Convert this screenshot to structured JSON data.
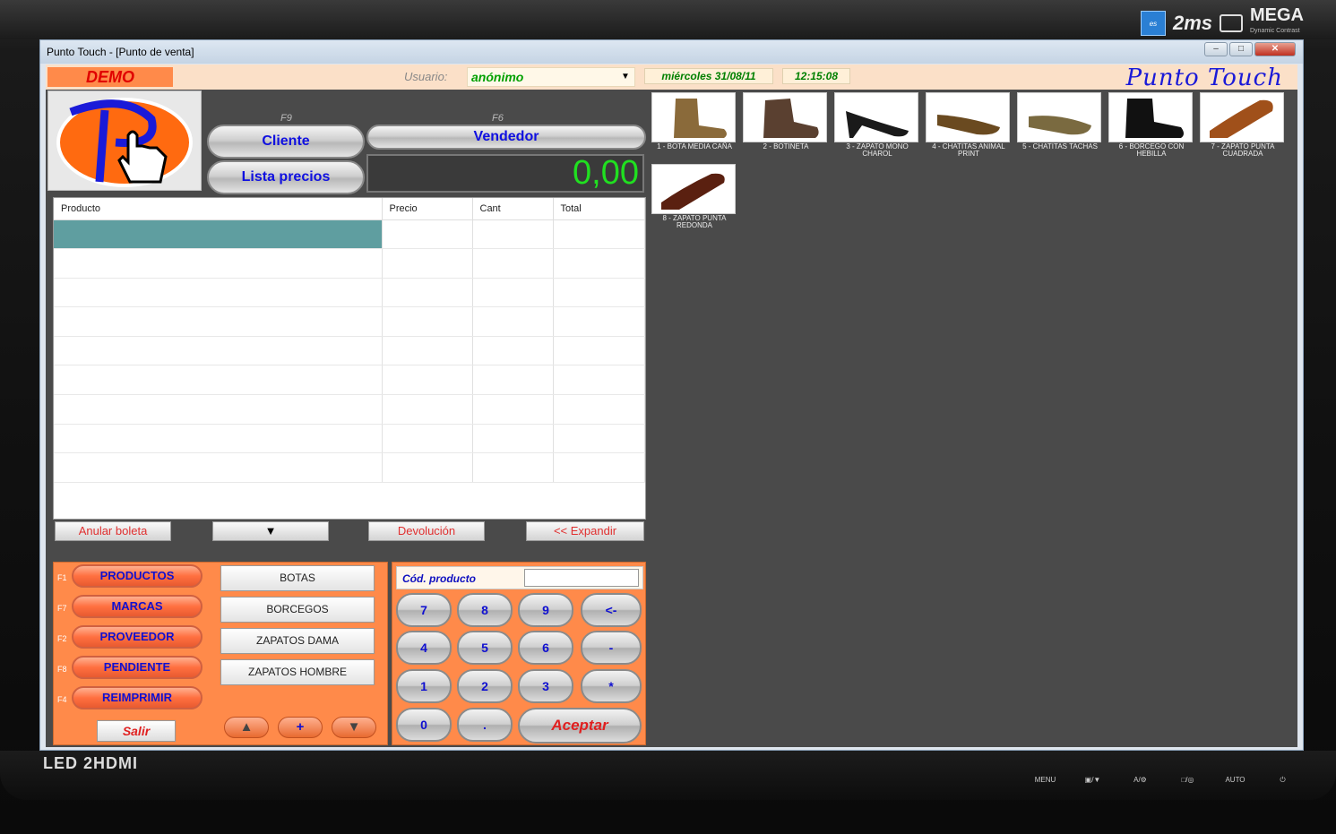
{
  "monitor": {
    "brand_ms": "2ms",
    "brand_mega": "MEGA",
    "brand_mega_sub": "Dynamic Contrast",
    "led_label": "LED 2HDMI",
    "buttons": [
      "MENU",
      "▣/▼",
      "A/⚙",
      "□/◎",
      "AUTO",
      "⏻"
    ]
  },
  "window": {
    "title": "Punto Touch - [Punto de venta]"
  },
  "topbar": {
    "demo": "DEMO",
    "user_label": "Usuario:",
    "user_value": "anónimo",
    "date": "miércoles 31/08/11",
    "time": "12:15:08",
    "brand": "Punto Touch"
  },
  "actions": {
    "f9": "F9",
    "f6": "F6",
    "cliente": "Cliente",
    "vendedor": "Vendedor",
    "lista_precios": "Lista precios",
    "total": "0,00"
  },
  "grid": {
    "columns": [
      "Producto",
      "Precio",
      "Cant",
      "Total"
    ],
    "rows": 10
  },
  "row_actions": {
    "anular": "Anular boleta",
    "devolucion": "Devolución",
    "expandir": "<< Expandir"
  },
  "categories": [
    {
      "fkey": "F1",
      "label": "PRODUCTOS"
    },
    {
      "fkey": "F7",
      "label": "MARCAS"
    },
    {
      "fkey": "F2",
      "label": "PROVEEDOR"
    },
    {
      "fkey": "F8",
      "label": "PENDIENTE"
    },
    {
      "fkey": "F4",
      "label": "REIMPRIMIR"
    }
  ],
  "subcategories": [
    "BOTAS",
    "BORCEGOS",
    "ZAPATOS DAMA",
    "ZAPATOS HOMBRE"
  ],
  "salir": "Salir",
  "nav": {
    "up": "▲",
    "plus": "+",
    "down": "▼"
  },
  "keypad": {
    "cod_label": "Cód. producto",
    "cod_value": "",
    "keys": [
      "7",
      "8",
      "9",
      "<-",
      "4",
      "5",
      "6",
      "-",
      "1",
      "2",
      "3",
      "*",
      "0",
      "."
    ],
    "aceptar": "Aceptar"
  },
  "products": [
    {
      "caption": "1 - BOTA MEDIA CAÑA",
      "color": "#8a6a3a"
    },
    {
      "caption": "2 - BOTINETA",
      "color": "#5a4030"
    },
    {
      "caption": "3 - ZAPATO MONO CHAROL",
      "color": "#1a1a1a"
    },
    {
      "caption": "4 - CHATITAS ANIMAL PRINT",
      "color": "#6a4a20"
    },
    {
      "caption": "5 - CHATITAS TACHAS",
      "color": "#7a6a40"
    },
    {
      "caption": "6 - BORCEGO CON HEBILLA",
      "color": "#111111"
    },
    {
      "caption": "7 - ZAPATO PUNTA CUADRADA",
      "color": "#a0501a"
    },
    {
      "caption": "8 - ZAPATO PUNTA REDONDA",
      "color": "#5a2010"
    }
  ]
}
